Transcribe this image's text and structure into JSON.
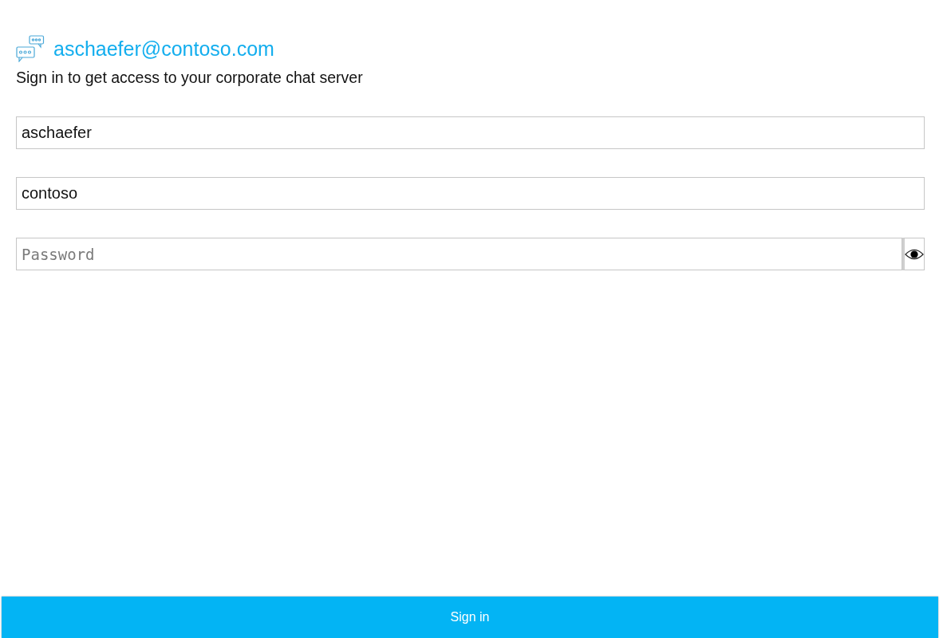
{
  "header": {
    "email": "aschaefer@contoso.com",
    "subtitle": "Sign in to get access to your corporate chat server"
  },
  "fields": [
    {
      "kind": "text",
      "value": "aschaefer"
    },
    {
      "kind": "text",
      "value": "contoso"
    },
    {
      "kind": "password",
      "placeholder": "Password",
      "reveal_button": true
    }
  ],
  "sign_in_button": "Sign in"
}
